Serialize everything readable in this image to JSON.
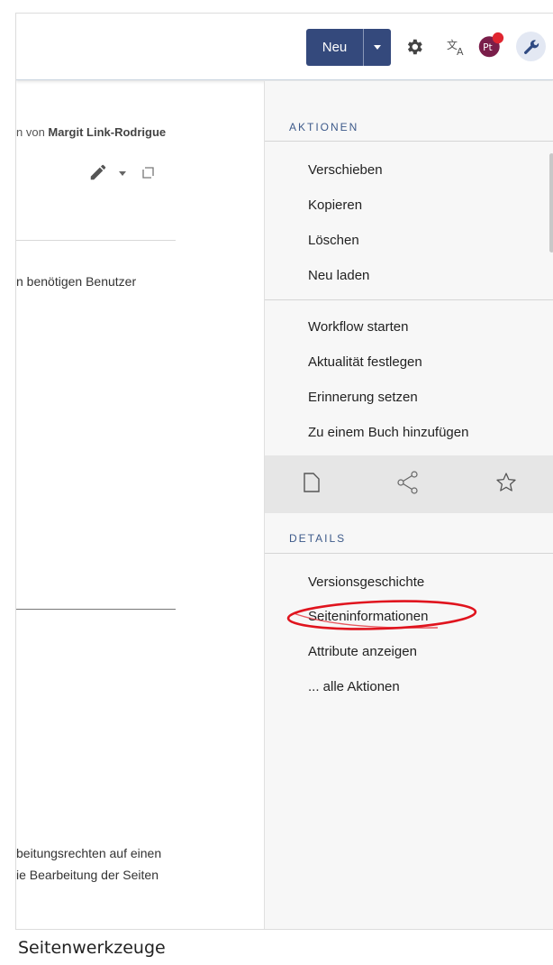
{
  "header": {
    "new_label": "Neu",
    "avatar_initials": "Pt"
  },
  "content": {
    "byline_prefix": "n von ",
    "byline_author": "Margit Link-Rodrigue",
    "line1": "n benötigen Benutzer",
    "line2": "beitungsrechten auf einen",
    "line3": "ie Bearbeitung der Seiten"
  },
  "sidebar": {
    "actions_heading": "AKTIONEN",
    "actions_group1": [
      "Verschieben",
      "Kopieren",
      "Löschen",
      "Neu laden"
    ],
    "actions_group2": [
      "Workflow starten",
      "Aktualität festlegen",
      "Erinnerung setzen",
      "Zu einem Buch hinzufügen"
    ],
    "details_heading": "DETAILS",
    "details_items": [
      "Versionsgeschichte",
      "Seiteninformationen",
      "Attribute anzeigen",
      "... alle Aktionen"
    ]
  },
  "caption": "Seitenwerkzeuge",
  "colors": {
    "primary": "#34497c",
    "section_heading": "#3d5a8a",
    "highlight": "#e0141e"
  },
  "icons": [
    "gear-icon",
    "translate-icon",
    "wrench-icon",
    "pencil-icon",
    "expand-icon",
    "page-icon",
    "share-icon",
    "star-icon"
  ]
}
